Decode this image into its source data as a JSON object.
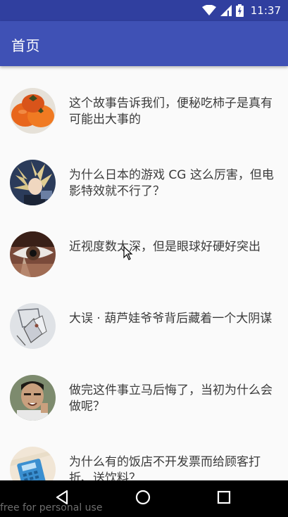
{
  "status_bar": {
    "time": "11:37",
    "icons": [
      "wifi-icon",
      "cellular-signal-icon",
      "battery-charging-icon"
    ]
  },
  "app_bar": {
    "title": "首页"
  },
  "list": {
    "items": [
      {
        "title": "这个故事告诉我们，便秘吃柿子是真有可能出大事的",
        "avatar": "persimmons"
      },
      {
        "title": "为什么日本的游戏 CG 这么厉害，但电影特效就不行了？",
        "avatar": "game-character"
      },
      {
        "title": "近视度数太深，但是眼球好硬好突出",
        "avatar": "eye"
      },
      {
        "title": "大误 · 葫芦娃爷爷背后藏着一个大阴谋",
        "avatar": "sketch-drawing"
      },
      {
        "title": "做完这件事立马后悔了，当初为什么会做呢？",
        "avatar": "man-face"
      },
      {
        "title": "为什么有的饭店不开发票而给顾客打折、送饮料？",
        "avatar": "calculator"
      }
    ]
  },
  "nav_bar": {
    "buttons": [
      "back-icon",
      "home-icon",
      "recents-icon"
    ]
  },
  "watermark": "free for personal use",
  "colors": {
    "status_bar": "#303f9f",
    "app_bar": "#3f51b5",
    "nav_bar": "#000000",
    "background": "#fafafa"
  }
}
